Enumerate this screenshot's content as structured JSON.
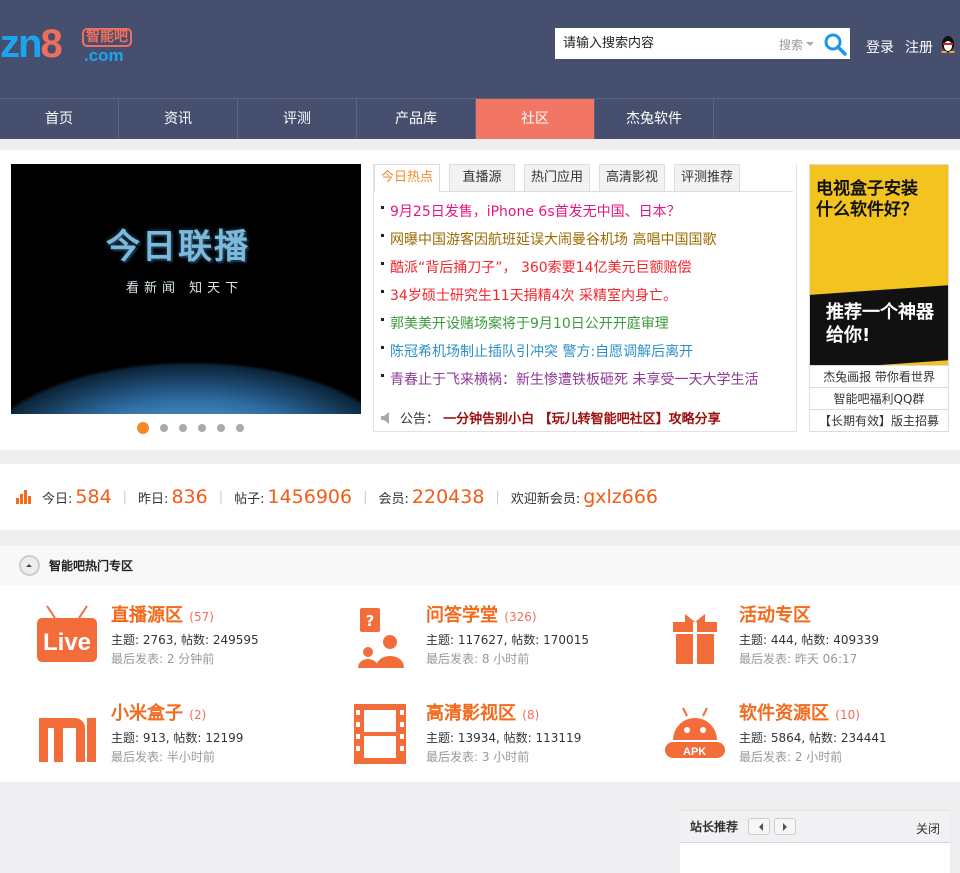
{
  "header": {
    "logo": {
      "prefix": "zn",
      "digit": "8",
      "brand": "智能吧",
      "domain": ".com"
    },
    "search_placeholder": "请输入搜索内容",
    "search_type": "搜索",
    "login": "登录",
    "register": "注册",
    "qq_icon": "qq-penguin-icon"
  },
  "nav": {
    "active": "社区",
    "items": [
      {
        "label": "首页"
      },
      {
        "label": "资讯"
      },
      {
        "label": "评测"
      },
      {
        "label": "产品库"
      },
      {
        "label": "社区"
      },
      {
        "label": "杰兔软件"
      }
    ]
  },
  "slider": {
    "title": "今日联播",
    "subtitle": "看新闻 知天下",
    "slides": 6,
    "current": 1
  },
  "tabs": {
    "items": [
      {
        "label": "今日热点"
      },
      {
        "label": "直播源"
      },
      {
        "label": "热门应用"
      },
      {
        "label": "高清影视"
      },
      {
        "label": "评测推荐"
      }
    ],
    "news": [
      {
        "text": "9月25日发售，iPhone 6s首发无中国、日本？",
        "color": "#e6157f"
      },
      {
        "text": "网曝中国游客因航班延误大闹曼谷机场 高唱中国国歌",
        "color": "#9b6c00"
      },
      {
        "text": "酷派“背后捅刀子”， 360索要14亿美元巨额赔偿",
        "color": "#f2262c"
      },
      {
        "text": "34岁硕士研究生11天捐精4次 采精室内身亡。",
        "color": "#f2262c"
      },
      {
        "text": "郭美美开设赌场案将于9月10日公开开庭审理",
        "color": "#3c9a3c"
      },
      {
        "text": "陈冠希机场制止插队引冲突 警方:自愿调解后离开",
        "color": "#2d90c9"
      },
      {
        "text": "青春止于飞来横祸：新生惨遭铁板砸死 未享受一天大学生活",
        "color": "#8e3a96"
      }
    ],
    "notice_label": "公告：",
    "notice": "一分钟告别小白 【玩儿转智能吧社区】攻略分享"
  },
  "ad": {
    "headline1": "电视盒子安装",
    "headline2": "什么软件好？",
    "slogan1": "推荐一个神器",
    "slogan2": "给你!",
    "links": [
      "杰兔画报 带你看世界",
      "智能吧福利QQ群",
      "【长期有效】版主招募"
    ]
  },
  "stats": {
    "today_label": "今日:",
    "today": "584",
    "yesterday_label": "昨日:",
    "yesterday": "836",
    "posts_label": "帖子:",
    "posts": "1456906",
    "members_label": "会员:",
    "members": "220438",
    "welcome_label": "欢迎新会员:",
    "newest": "gxlz666"
  },
  "hot": {
    "title": "智能吧热门专区",
    "forums": [
      {
        "name": "直播源区",
        "count": "(57)",
        "stats": "主题: 2763, 帖数: 249595",
        "last": "最后发表: 2 分钟前",
        "icon": "live-tv-icon"
      },
      {
        "name": "问答学堂",
        "count": "(326)",
        "stats": "主题: 117627, 帖数: 170015",
        "last": "最后发表: 8 小时前",
        "icon": "question-people-icon"
      },
      {
        "name": "活动专区",
        "count": "",
        "stats": "主题: 444, 帖数: 409339",
        "last": "最后发表: 昨天 06:17",
        "icon": "gift-icon"
      },
      {
        "name": "小米盒子",
        "count": "(2)",
        "stats": "主题: 913, 帖数: 12199",
        "last": "最后发表: 半小时前",
        "icon": "mi-logo-icon"
      },
      {
        "name": "高清影视区",
        "count": "(8)",
        "stats": "主题: 13934, 帖数: 113119",
        "last": "最后发表: 3 小时前",
        "icon": "film-strip-icon"
      },
      {
        "name": "软件资源区",
        "count": "(10)",
        "stats": "主题: 5864, 帖数: 234441",
        "last": "最后发表: 2 小时前",
        "icon": "android-apk-icon"
      }
    ]
  },
  "float": {
    "title": "站长推荐",
    "close": "关闭"
  },
  "colors": {
    "header": "#474f6f",
    "nav_active": "#f37563",
    "accent": "#f26a1b"
  }
}
